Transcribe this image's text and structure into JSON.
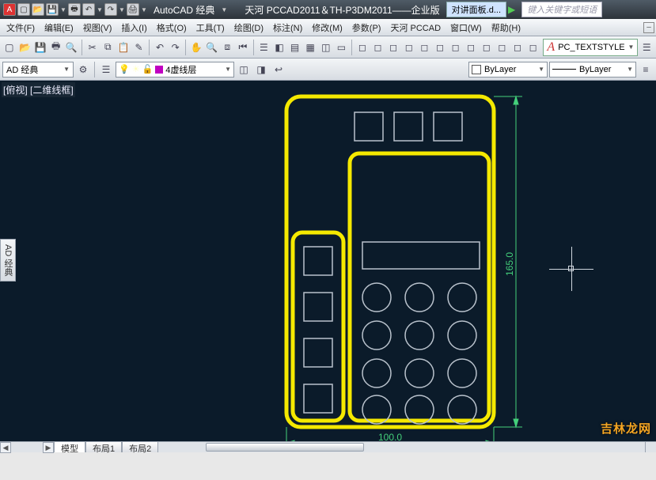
{
  "title": {
    "workspace_name": "AutoCAD 经典",
    "product_title": "天河 PCCAD2011＆TH-P3DM2011——企业版",
    "document_tab": "对讲面板.d...",
    "search_placeholder": "键入关键字或短语"
  },
  "menu": [
    "文件(F)",
    "编辑(E)",
    "视图(V)",
    "插入(I)",
    "格式(O)",
    "工具(T)",
    "绘图(D)",
    "标注(N)",
    "修改(M)",
    "参数(P)",
    "天河 PCCAD",
    "窗口(W)",
    "帮助(H)"
  ],
  "text_style": {
    "current": "PC_TEXTSTYLE"
  },
  "workspace_dd": "AD 经典",
  "layer": {
    "name": "4虚线层",
    "color": "#c000c0"
  },
  "color_control": "ByLayer",
  "linetype_control": "ByLayer",
  "viewport": {
    "label": "[俯视] [二维线框]",
    "side_tab": "AD 经典"
  },
  "layout_tabs": [
    "模型",
    "布局1",
    "布局2"
  ],
  "watermark": "吉林龙网",
  "drawing": {
    "dim_width": "100.0",
    "dim_height": "165.0"
  },
  "icons": {
    "new": "□",
    "open": "📂",
    "save": "💾",
    "print": "🖨",
    "undo": "↶",
    "redo": "↷"
  }
}
